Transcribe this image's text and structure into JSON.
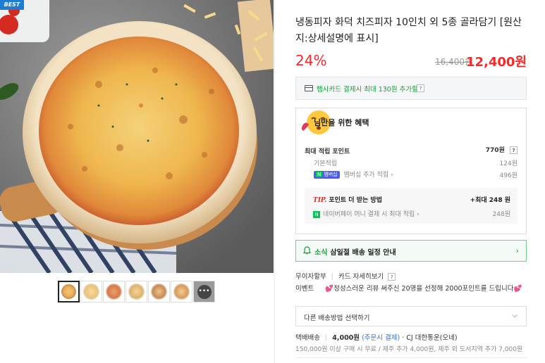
{
  "gallery": {
    "badge": "BEST",
    "thumb_count": 7,
    "more_label": "•••"
  },
  "product": {
    "title": "냉동피자 화덕 치즈피자 10인치 외 5종 골라담기 [원산지:상세설명에 표시]",
    "discount_rate": "24%",
    "original_price": "16,400원",
    "sale_price": "12,400원"
  },
  "card_promo": {
    "text": "햄사카드 결제시 최대 130원 추가할인",
    "help": "?"
  },
  "benefits": {
    "title": "님만을 위한 혜택",
    "max_points_label": "최대 적립 포인트",
    "max_points_value": "770원",
    "help": "?",
    "basic_label": "기본적립",
    "basic_value": "124원",
    "membership_badge_n": "N",
    "membership_badge": "멤버십",
    "membership_label": "멤버십 추가 적립",
    "membership_value": "496원",
    "tip_mark": "TIP.",
    "tip_label": "포인트 더 받는 방법",
    "tip_value": "+최대 248 원",
    "naverpay_icon": "N",
    "naverpay_label": "네이버페이 머니 결제 시 최대 적립",
    "naverpay_value": "248원"
  },
  "notice": {
    "tag": "소식",
    "text": "삼일절 배송 일정 안내"
  },
  "payment": {
    "installment": "무이자할부",
    "card_detail": "카드 자세히보기",
    "help": "?"
  },
  "event": {
    "label": "이벤트",
    "text": "💕정성스러운 리뷰 써주신 20명을 선정해 2000포인트를 드립니다💕"
  },
  "delivery_select": {
    "placeholder": "다른 배송방법 선택하기"
  },
  "shipping": {
    "label": "택배배송",
    "fee": "4,000원",
    "fee_note": "(주문시 결제)",
    "carrier": "· CJ 대한통운(오네)",
    "conditions": "150,000원 이상 구매 시 무료 / 제주 추가 4,000원, 제주 외 도서지역 추가 7,000원"
  },
  "colors": {
    "price_red": "#fa2828",
    "naver_green": "#1a9e38",
    "badge_blue": "#1e7bd6"
  }
}
